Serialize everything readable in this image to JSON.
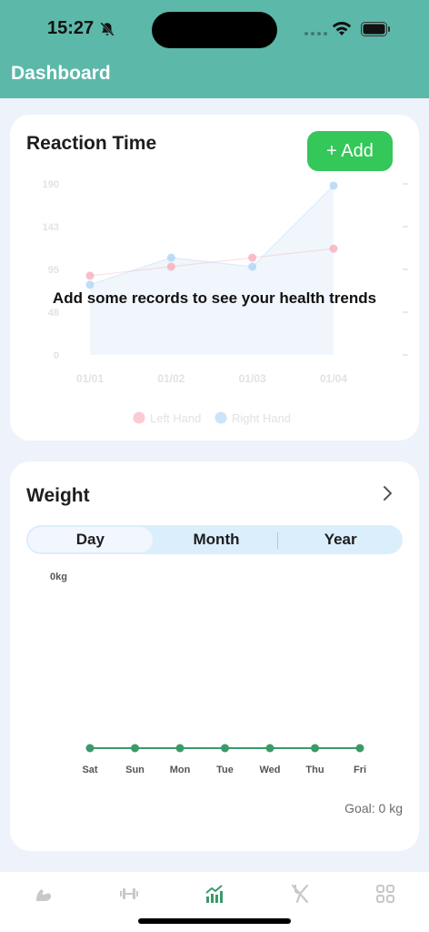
{
  "status": {
    "time": "15:27"
  },
  "header": {
    "title": "Dashboard"
  },
  "reaction": {
    "title": "Reaction Time",
    "add_label": "+ Add",
    "empty_message": "Add some records to see your health trends"
  },
  "weight": {
    "title": "Weight",
    "segments": [
      "Day",
      "Month",
      "Year"
    ],
    "active_segment": "Day",
    "y_label": "0kg",
    "goal": "Goal: 0 kg"
  },
  "colors": {
    "header": "#5cb8a8",
    "accent": "#34c759",
    "weight_line": "#3a9a6a",
    "left_hand": "#f7a8b8",
    "right_hand": "#a9d2f5"
  },
  "icons": [
    "arm-icon",
    "dumbbell-icon",
    "chart-icon",
    "utensils-icon",
    "grid-icon"
  ],
  "chart_data": [
    {
      "type": "line",
      "title": "",
      "categories": [
        "01/01",
        "01/02",
        "01/03",
        "01/04"
      ],
      "y_ticks": [
        "190",
        "143",
        "95",
        "48",
        "0"
      ],
      "ylim": [
        0,
        190
      ],
      "series": [
        {
          "name": "Left Hand",
          "values": [
            88,
            98,
            108,
            118
          ]
        },
        {
          "name": "Right Hand",
          "values": [
            78,
            108,
            98,
            188
          ]
        }
      ],
      "legend": "bottom"
    },
    {
      "type": "line",
      "title": "",
      "categories": [
        "Sat",
        "Sun",
        "Mon",
        "Tue",
        "Wed",
        "Thu",
        "Fri"
      ],
      "values": [
        0,
        0,
        0,
        0,
        0,
        0,
        0
      ],
      "ylabel": "0kg"
    }
  ]
}
